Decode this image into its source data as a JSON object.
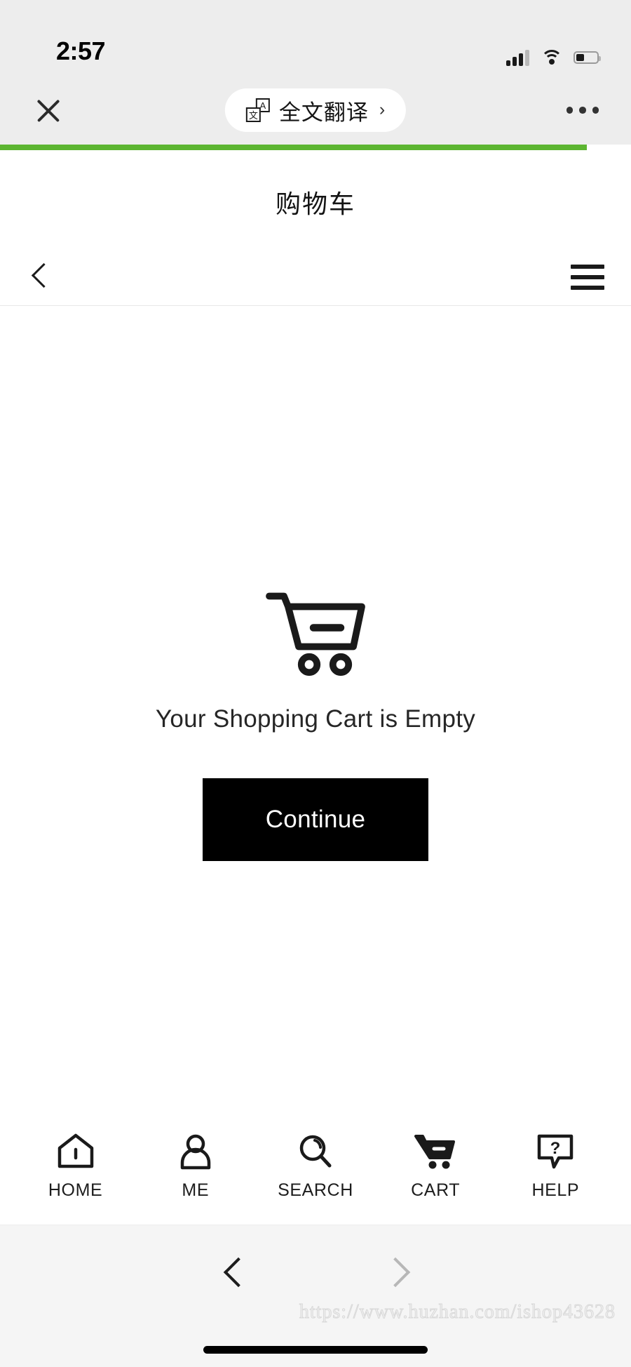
{
  "status_bar": {
    "time": "2:57",
    "signal_icon": "cellular-signal-icon",
    "wifi_icon": "wifi-icon",
    "battery_icon": "battery-icon",
    "battery_level_pct": 40
  },
  "wechat_chrome": {
    "close_icon": "close-icon",
    "translate": {
      "icon": "translate-icon",
      "icon_top_char": "A",
      "icon_bottom_char": "文",
      "label": "全文翻译",
      "chevron": "›"
    },
    "more_icon": "more-options-icon",
    "progress_pct": 93,
    "progress_color": "#5cb531",
    "chrome_bg": "#ededed"
  },
  "page": {
    "title": "购物车",
    "site_nav": {
      "back_icon": "chevron-left-icon",
      "menu_icon": "hamburger-menu-icon"
    },
    "cart": {
      "empty_icon": "shopping-cart-icon",
      "empty_message": "Your Shopping Cart is Empty",
      "continue_label": "Continue",
      "continue_bg": "#000000",
      "continue_fg": "#ffffff"
    },
    "tabbar": [
      {
        "label": "HOME",
        "icon": "home-icon"
      },
      {
        "label": "ME",
        "icon": "person-icon"
      },
      {
        "label": "SEARCH",
        "icon": "search-icon"
      },
      {
        "label": "CART",
        "icon": "cart-icon"
      },
      {
        "label": "HELP",
        "icon": "help-question-icon"
      }
    ]
  },
  "browser_bar": {
    "back_icon": "browser-back-icon",
    "forward_icon": "browser-forward-icon",
    "forward_disabled": true,
    "watermark": "https://www.huzhan.com/ishop43628",
    "home_indicator": "home-indicator"
  }
}
